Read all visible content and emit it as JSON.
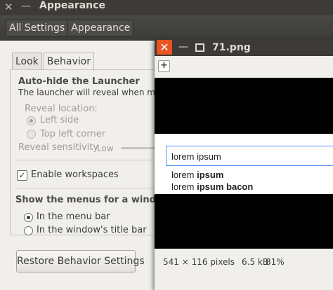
{
  "window": {
    "title": "Appearance",
    "close_glyph": "✕",
    "minimize_glyph": "—"
  },
  "breadcrumbs": [
    "All Settings",
    "Appearance"
  ],
  "tabs": [
    {
      "label": "Look",
      "active": false
    },
    {
      "label": "Behavior",
      "active": true
    }
  ],
  "launcher": {
    "heading": "Auto-hide the Launcher",
    "description": "The launcher will reveal when movin",
    "reveal_location_label": "Reveal location:",
    "options": [
      {
        "label": "Left side",
        "selected": true
      },
      {
        "label": "Top left corner",
        "selected": false
      }
    ],
    "sensitivity_label": "Reveal sensitivity",
    "sensitivity_value": "Low"
  },
  "workspaces": {
    "label": "Enable workspaces",
    "checked": true,
    "check_glyph": "✓"
  },
  "menus": {
    "heading": "Show the menus for a window",
    "options": [
      {
        "label": "In the menu bar",
        "selected": true
      },
      {
        "label": "In the window's title bar",
        "selected": false
      }
    ]
  },
  "restore_button": "Restore Behavior Settings",
  "viewer": {
    "close_glyph": "✕",
    "minimize_glyph": "—",
    "filename": "71.png",
    "toolbar_button_glyph": "+",
    "image": {
      "search_text": "lorem ipsum",
      "suggestions": [
        {
          "plain": "lorem ",
          "bold": "ipsum"
        },
        {
          "plain": "lorem ",
          "bold": "ipsum bacon"
        }
      ]
    },
    "status": {
      "dimensions": "541 × 116 pixels",
      "size": "6.5 kB",
      "zoom": "81%"
    }
  },
  "colors": {
    "title_bar": "#3c3b37",
    "close_accent": "#e95420",
    "focus_border": "#4d90fe"
  }
}
